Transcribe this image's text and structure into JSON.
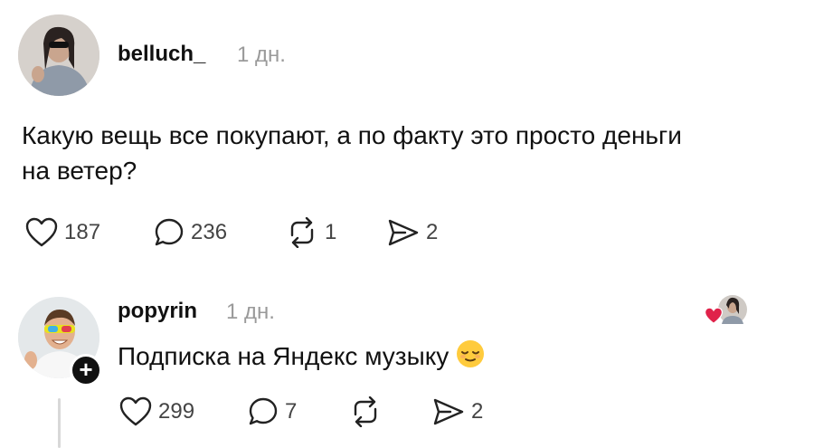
{
  "post": {
    "username": "belluch_",
    "time": "1 дн.",
    "text_line1": "Какую вещь все покупают, а по факту это просто деньги",
    "text_line2": "на ветер?",
    "likes": "187",
    "comments": "236",
    "reposts": "1",
    "shares": "2"
  },
  "reply": {
    "username": "popyrin",
    "time": "1 дн.",
    "text": "Подписка на Яндекс музыку",
    "likes": "299",
    "comments": "7",
    "reposts": "",
    "shares": "2",
    "follow_badge": "+"
  },
  "icons": {
    "like": "heart-icon",
    "comment": "comment-icon",
    "repost": "repost-icon",
    "share": "send-icon",
    "liked_by": "heart-red-icon",
    "emoji": "relieved-face-emoji"
  },
  "colors": {
    "text": "#111111",
    "muted": "#9a9a9a",
    "heart_red": "#e0224a"
  }
}
